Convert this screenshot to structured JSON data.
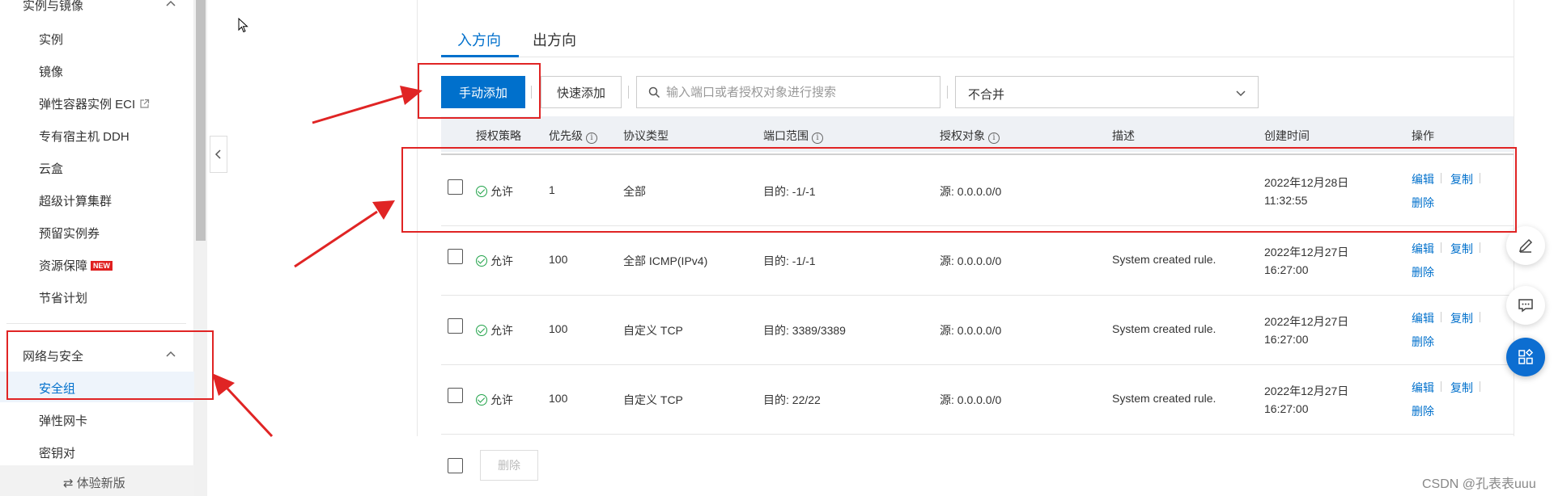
{
  "sidebar": {
    "group1_title": "实例与镜像",
    "group1_items": [
      "实例",
      "镜像",
      "弹性容器实例 ECI",
      "专有宿主机 DDH",
      "云盒",
      "超级计算集群",
      "预留实例券",
      "资源保障",
      "节省计划"
    ],
    "new_badge": "NEW",
    "group2_title": "网络与安全",
    "group2_items": [
      "安全组",
      "弹性网卡",
      "密钥对"
    ],
    "footer_label": "⇄ 体验新版"
  },
  "tabs": [
    "入方向",
    "出方向"
  ],
  "toolbar": {
    "manual_add": "手动添加",
    "quick_add": "快速添加",
    "search_placeholder": "输入端口或者授权对象进行搜索",
    "merge_select": "不合并"
  },
  "table": {
    "headers": [
      "授权策略",
      "优先级",
      "协议类型",
      "端口范围",
      "授权对象",
      "描述",
      "创建时间",
      "操作"
    ],
    "rows": [
      {
        "policy": "允许",
        "priority": "1",
        "protocol": "全部",
        "port": "目的: -1/-1",
        "source": "源: 0.0.0.0/0",
        "desc": "",
        "date": "2022年12月28日",
        "time": "11:32:55"
      },
      {
        "policy": "允许",
        "priority": "100",
        "protocol": "全部 ICMP(IPv4)",
        "port": "目的: -1/-1",
        "source": "源: 0.0.0.0/0",
        "desc": "System created rule.",
        "date": "2022年12月27日",
        "time": "16:27:00"
      },
      {
        "policy": "允许",
        "priority": "100",
        "protocol": "自定义 TCP",
        "port": "目的: 3389/3389",
        "source": "源: 0.0.0.0/0",
        "desc": "System created rule.",
        "date": "2022年12月27日",
        "time": "16:27:00"
      },
      {
        "policy": "允许",
        "priority": "100",
        "protocol": "自定义 TCP",
        "port": "目的: 22/22",
        "source": "源: 0.0.0.0/0",
        "desc": "System created rule.",
        "date": "2022年12月27日",
        "time": "16:27:00"
      }
    ],
    "actions": {
      "edit": "编辑",
      "copy": "复制",
      "delete": "删除"
    },
    "bulk_delete": "删除"
  },
  "watermark": "CSDN @孔表表uuu",
  "colors": {
    "accent": "#0070cc",
    "annotation": "#e02424",
    "allow": "#22a34a"
  }
}
